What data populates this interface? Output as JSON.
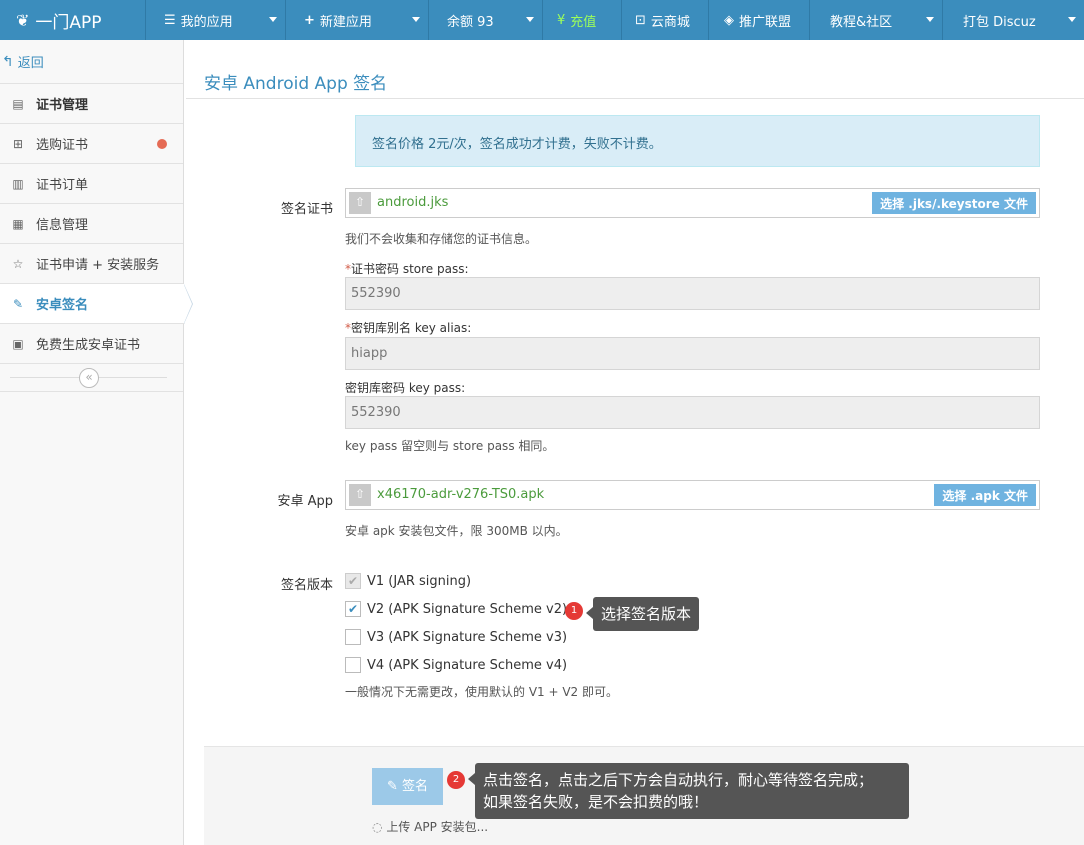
{
  "brand": {
    "name": "一门APP"
  },
  "nav": {
    "my_apps": "我的应用",
    "new_app": "新建应用",
    "balance": "余额 93",
    "recharge": "充值",
    "cloud_mall": "云商城",
    "affiliate": "推广联盟",
    "community": "教程&社区",
    "package": "打包 Discuz"
  },
  "sidebar": {
    "back": "返回",
    "items": [
      {
        "label": "证书管理",
        "icon": "certificate-icon"
      },
      {
        "label": "选购证书",
        "icon": "cart-icon"
      },
      {
        "label": "证书订单",
        "icon": "order-icon"
      },
      {
        "label": "信息管理",
        "icon": "info-icon"
      },
      {
        "label": "证书申请 + 安装服务",
        "icon": "star-icon"
      },
      {
        "label": "安卓签名",
        "icon": "pen-icon"
      },
      {
        "label": "免费生成安卓证书",
        "icon": "badge-icon"
      }
    ]
  },
  "page": {
    "title": "安卓 Android App 签名"
  },
  "alert": {
    "text": "签名价格 2元/次，签名成功才计费，失败不计费。"
  },
  "cert": {
    "label": "签名证书",
    "filename": "android.jks",
    "pick_label": "选择 .jks/.keystore 文件",
    "help": "我们不会收集和存储您的证书信息。",
    "store_pass_label": "证书密码 store pass:",
    "store_pass_value": "552390",
    "alias_label": "密钥库别名 key alias:",
    "alias_value": "hiapp",
    "key_pass_label": "密钥库密码 key pass:",
    "key_pass_value": "552390",
    "key_pass_help": "key pass 留空则与 store pass 相同。",
    "required_mark": "*"
  },
  "apk": {
    "label": "安卓 App",
    "filename": "x46170-adr-v276-TS0.apk",
    "pick_label": "选择 .apk 文件",
    "help": "安卓 apk 安装包文件，限 300MB 以内。"
  },
  "version": {
    "label": "签名版本",
    "options": [
      {
        "label": "V1 (JAR signing)",
        "checked": true,
        "disabled": true
      },
      {
        "label": "V2 (APK Signature Scheme v2)",
        "checked": true,
        "disabled": false
      },
      {
        "label": "V3 (APK Signature Scheme v3)",
        "checked": false,
        "disabled": false
      },
      {
        "label": "V4 (APK Signature Scheme v4)",
        "checked": false,
        "disabled": false
      }
    ],
    "help": "一般情况下无需更改，使用默认的 V1 + V2 即可。"
  },
  "tips": {
    "badge1": "1",
    "tip1": "选择签名版本",
    "badge2": "2",
    "tip2_line1": "点击签名，点击之后下方会自动执行，耐心等待签名完成；",
    "tip2_line2": "如果签名失败，是不会扣费的哦！"
  },
  "actions": {
    "sign_label": "签名",
    "uploading": "上传 APP 安装包..."
  },
  "colors": {
    "topbar": "#3b8dbd",
    "accent": "#3b8dbd",
    "alert_bg": "#d9edf7",
    "button": "#9cc9e8",
    "badge": "#e53935"
  }
}
